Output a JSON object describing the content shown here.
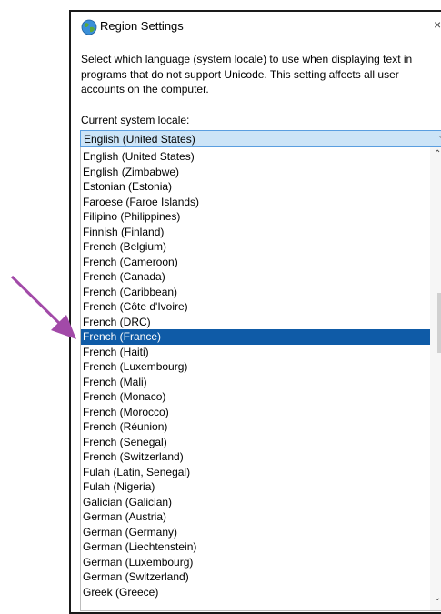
{
  "window": {
    "title": "Region Settings",
    "title_icon": "globe-icon",
    "close_glyph": "×"
  },
  "description": "Select which language (system locale) to use when displaying text in programs that do not support Unicode. This setting affects all user accounts on the computer.",
  "locale_label": "Current system locale:",
  "current_locale": "English (United States)",
  "dropdown_icon": "chevron-down-icon",
  "locale_options": [
    "English (United States)",
    "English (Zimbabwe)",
    "Estonian (Estonia)",
    "Faroese (Faroe Islands)",
    "Filipino (Philippines)",
    "Finnish (Finland)",
    "French (Belgium)",
    "French (Cameroon)",
    "French (Canada)",
    "French (Caribbean)",
    "French (Côte d'Ivoire)",
    "French (DRC)",
    "French (France)",
    "French (Haiti)",
    "French (Luxembourg)",
    "French (Mali)",
    "French (Monaco)",
    "French (Morocco)",
    "French (Réunion)",
    "French (Senegal)",
    "French (Switzerland)",
    "Fulah (Latin, Senegal)",
    "Fulah (Nigeria)",
    "Galician (Galician)",
    "German (Austria)",
    "German (Germany)",
    "German (Liechtenstein)",
    "German (Luxembourg)",
    "German (Switzerland)",
    "Greek (Greece)"
  ],
  "highlighted_option": "French (France)",
  "colors": {
    "selection": "#0f5ba7",
    "combo_fill": "#cce4f7",
    "annotation_arrow": "#a24aa8"
  }
}
